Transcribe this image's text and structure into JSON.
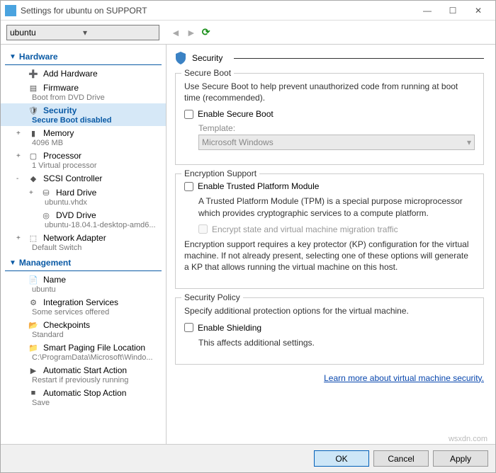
{
  "window": {
    "title": "Settings for ubuntu on SUPPORT",
    "min": "—",
    "max": "☐",
    "close": "✕"
  },
  "vmselect": {
    "value": "ubuntu"
  },
  "sidebar": {
    "hardware_header": "Hardware",
    "management_header": "Management",
    "hardware": [
      {
        "icon": "➕",
        "label": "Add Hardware",
        "sub": ""
      },
      {
        "icon": "▤",
        "label": "Firmware",
        "sub": "Boot from DVD Drive"
      },
      {
        "icon": "🛡",
        "label": "Security",
        "sub": "Secure Boot disabled",
        "selected": true
      },
      {
        "icon": "▮",
        "label": "Memory",
        "sub": "4096 MB",
        "tree": "+"
      },
      {
        "icon": "▢",
        "label": "Processor",
        "sub": "1 Virtual processor",
        "tree": "+"
      },
      {
        "icon": "◆",
        "label": "SCSI Controller",
        "sub": "",
        "tree": "-"
      },
      {
        "icon": "⛁",
        "label": "Hard Drive",
        "sub": "ubuntu.vhdx",
        "tree": "+",
        "indent": true
      },
      {
        "icon": "◎",
        "label": "DVD Drive",
        "sub": "ubuntu-18.04.1-desktop-amd6...",
        "indent": true
      },
      {
        "icon": "⬚",
        "label": "Network Adapter",
        "sub": "Default Switch",
        "tree": "+"
      }
    ],
    "management": [
      {
        "icon": "📄",
        "label": "Name",
        "sub": "ubuntu"
      },
      {
        "icon": "⚙",
        "label": "Integration Services",
        "sub": "Some services offered"
      },
      {
        "icon": "📂",
        "label": "Checkpoints",
        "sub": "Standard"
      },
      {
        "icon": "📁",
        "label": "Smart Paging File Location",
        "sub": "C:\\ProgramData\\Microsoft\\Windo..."
      },
      {
        "icon": "▶",
        "label": "Automatic Start Action",
        "sub": "Restart if previously running"
      },
      {
        "icon": "■",
        "label": "Automatic Stop Action",
        "sub": "Save"
      }
    ]
  },
  "content": {
    "title": "Security",
    "secure_boot": {
      "legend": "Secure Boot",
      "desc": "Use Secure Boot to help prevent unauthorized code from running at boot time (recommended).",
      "checkbox": "Enable Secure Boot",
      "template_label": "Template:",
      "template_value": "Microsoft Windows"
    },
    "encryption": {
      "legend": "Encryption Support",
      "checkbox": "Enable Trusted Platform Module",
      "tpm_desc": "A Trusted Platform Module (TPM) is a special purpose microprocessor which provides cryptographic services to a compute platform.",
      "encrypt_state": "Encrypt state and virtual machine migration traffic",
      "kp_desc": "Encryption support requires a key protector (KP) configuration for the virtual machine. If not already present, selecting one of these options will generate a KP that allows running the virtual machine on this host."
    },
    "security_policy": {
      "legend": "Security Policy",
      "desc": "Specify additional protection options for the virtual machine.",
      "checkbox": "Enable Shielding",
      "sub": "This affects additional settings."
    },
    "link": "Learn more about virtual machine security."
  },
  "footer": {
    "ok": "OK",
    "cancel": "Cancel",
    "apply": "Apply"
  },
  "watermark": "wsxdn.com"
}
